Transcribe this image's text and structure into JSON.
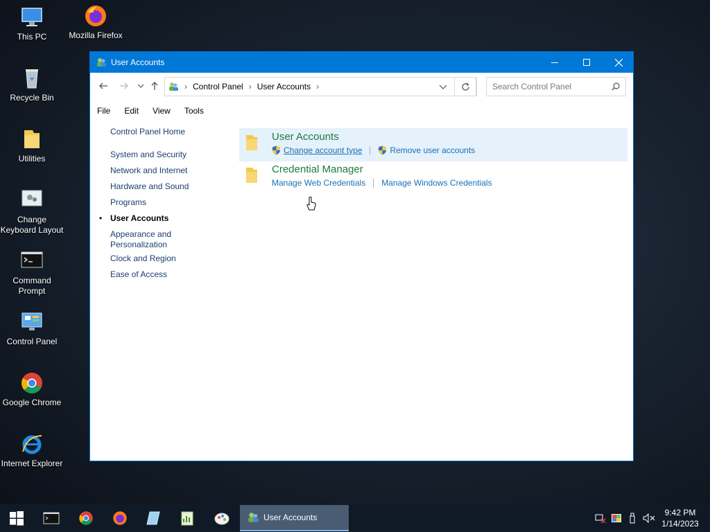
{
  "desktop": {
    "icons": [
      {
        "label": "This PC"
      },
      {
        "label": "Mozilla Firefox"
      },
      {
        "label": "Recycle Bin"
      },
      {
        "label": "Utilities"
      },
      {
        "label": "Change Keyboard Layout"
      },
      {
        "label": "Command Prompt"
      },
      {
        "label": "Control Panel"
      },
      {
        "label": "Google Chrome"
      },
      {
        "label": "Internet Explorer"
      }
    ]
  },
  "window": {
    "title": "User Accounts",
    "breadcrumb": [
      "Control Panel",
      "User Accounts"
    ],
    "search_placeholder": "Search Control Panel",
    "menu": [
      "File",
      "Edit",
      "View",
      "Tools"
    ],
    "sidebar": {
      "home": "Control Panel Home",
      "items": [
        {
          "label": "System and Security"
        },
        {
          "label": "Network and Internet"
        },
        {
          "label": "Hardware and Sound"
        },
        {
          "label": "Programs"
        },
        {
          "label": "User Accounts",
          "active": true
        },
        {
          "label": "Appearance and Personalization"
        },
        {
          "label": "Clock and Region"
        },
        {
          "label": "Ease of Access"
        }
      ]
    },
    "categories": [
      {
        "title": "User Accounts",
        "links": [
          "Change account type",
          "Remove user accounts"
        ]
      },
      {
        "title": "Credential Manager",
        "links": [
          "Manage Web Credentials",
          "Manage Windows Credentials"
        ]
      }
    ]
  },
  "taskbar": {
    "active_window": "User Accounts",
    "time": "9:42 PM",
    "date": "1/14/2023"
  },
  "colors": {
    "accent": "#0078d7",
    "link": "#1a6fb3",
    "category_title": "#1e7b3c",
    "highlight": "#e5f1fb"
  }
}
